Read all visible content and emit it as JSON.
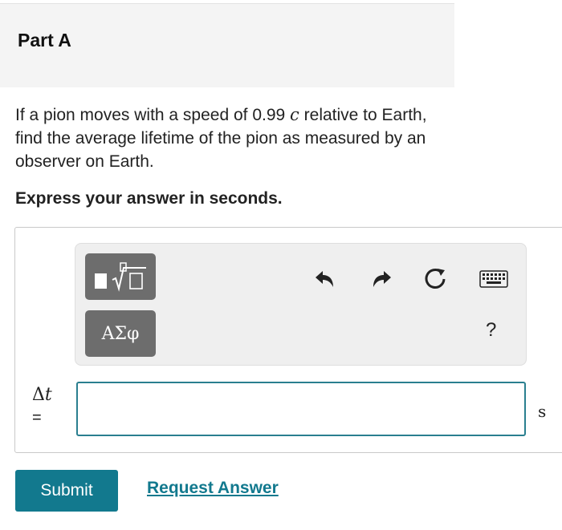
{
  "part": {
    "title": "Part A"
  },
  "question": {
    "text_before": "If a pion moves with a speed of 0.99 ",
    "variable": "c",
    "text_after": " relative to Earth, find the average lifetime of the pion as measured by an observer on Earth."
  },
  "instruction": "Express your answer in seconds.",
  "toolbar": {
    "templates_icon": "templates-icon",
    "symbols_label": "ΑΣφ",
    "undo_icon": "undo-icon",
    "redo_icon": "redo-icon",
    "reset_icon": "reset-icon",
    "keyboard_icon": "keyboard-icon",
    "help_label": "?"
  },
  "answer": {
    "variable_delta": "Δ",
    "variable_name": "t",
    "equals": "=",
    "value": "",
    "unit": "s"
  },
  "actions": {
    "submit_label": "Submit",
    "request_answer_label": "Request Answer"
  },
  "colors": {
    "accent": "#12798e",
    "input_border": "#2a7f8f",
    "tool_button": "#6d6d6d"
  }
}
